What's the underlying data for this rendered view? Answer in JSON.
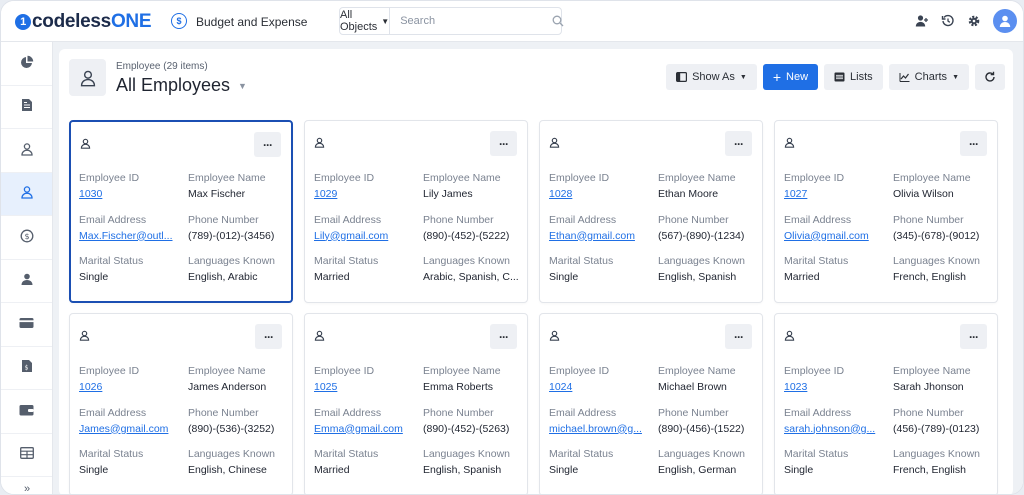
{
  "brand": {
    "logo_mark": "1",
    "logo_text": "codeless",
    "logo_accent": "ONE"
  },
  "app": {
    "title": "Budget and Expense",
    "icon_glyph": "$"
  },
  "search": {
    "object_select": "All Objects",
    "placeholder": "Search"
  },
  "sidebar": {
    "items": [
      {
        "icon": "pie-chart-icon"
      },
      {
        "icon": "document-icon"
      },
      {
        "icon": "user-icon"
      },
      {
        "icon": "user-icon",
        "active": true
      },
      {
        "icon": "dollar-icon"
      },
      {
        "icon": "user-group-icon"
      },
      {
        "icon": "credit-card-icon"
      },
      {
        "icon": "invoice-icon"
      },
      {
        "icon": "wallet-icon"
      },
      {
        "icon": "table-icon"
      }
    ],
    "expand_glyph": "»"
  },
  "header": {
    "subtitle": "Employee (29 items)",
    "title": "All Employees"
  },
  "toolbar": {
    "show_as": "Show As",
    "new": "New",
    "lists": "Lists",
    "charts": "Charts"
  },
  "labels": {
    "id": "Employee ID",
    "name": "Employee Name",
    "email": "Email Address",
    "phone": "Phone Number",
    "marital": "Marital Status",
    "languages": "Languages Known"
  },
  "menu_glyph": "···",
  "employees": [
    {
      "id": "1030",
      "name": "Max Fischer",
      "email": "Max.Fischer@outl...",
      "phone": "(789)-(012)-(3456)",
      "marital": "Single",
      "languages": "English, Arabic"
    },
    {
      "id": "1029",
      "name": "Lily James",
      "email": "Lily@gmail.com",
      "phone": "(890)-(452)-(5222)",
      "marital": "Married",
      "languages": "Arabic, Spanish, C..."
    },
    {
      "id": "1028",
      "name": "Ethan Moore",
      "email": "Ethan@gmail.com",
      "phone": "(567)-(890)-(1234)",
      "marital": "Single",
      "languages": "English, Spanish"
    },
    {
      "id": "1027",
      "name": "Olivia Wilson",
      "email": "Olivia@gmail.com",
      "phone": "(345)-(678)-(9012)",
      "marital": "Married",
      "languages": "French, English"
    },
    {
      "id": "1026",
      "name": "James Anderson",
      "email": "James@gmail.com",
      "phone": "(890)-(536)-(3252)",
      "marital": "Single",
      "languages": "English, Chinese"
    },
    {
      "id": "1025",
      "name": "Emma Roberts",
      "email": "Emma@gmail.com",
      "phone": "(890)-(452)-(5263)",
      "marital": "Married",
      "languages": "English, Spanish"
    },
    {
      "id": "1024",
      "name": "Michael Brown",
      "email": "michael.brown@g...",
      "phone": "(890)-(456)-(1522)",
      "marital": "Single",
      "languages": "English, German"
    },
    {
      "id": "1023",
      "name": "Sarah Jhonson",
      "email": "sarah.johnson@g...",
      "phone": "(456)-(789)-(0123)",
      "marital": "Single",
      "languages": "French, English"
    }
  ]
}
